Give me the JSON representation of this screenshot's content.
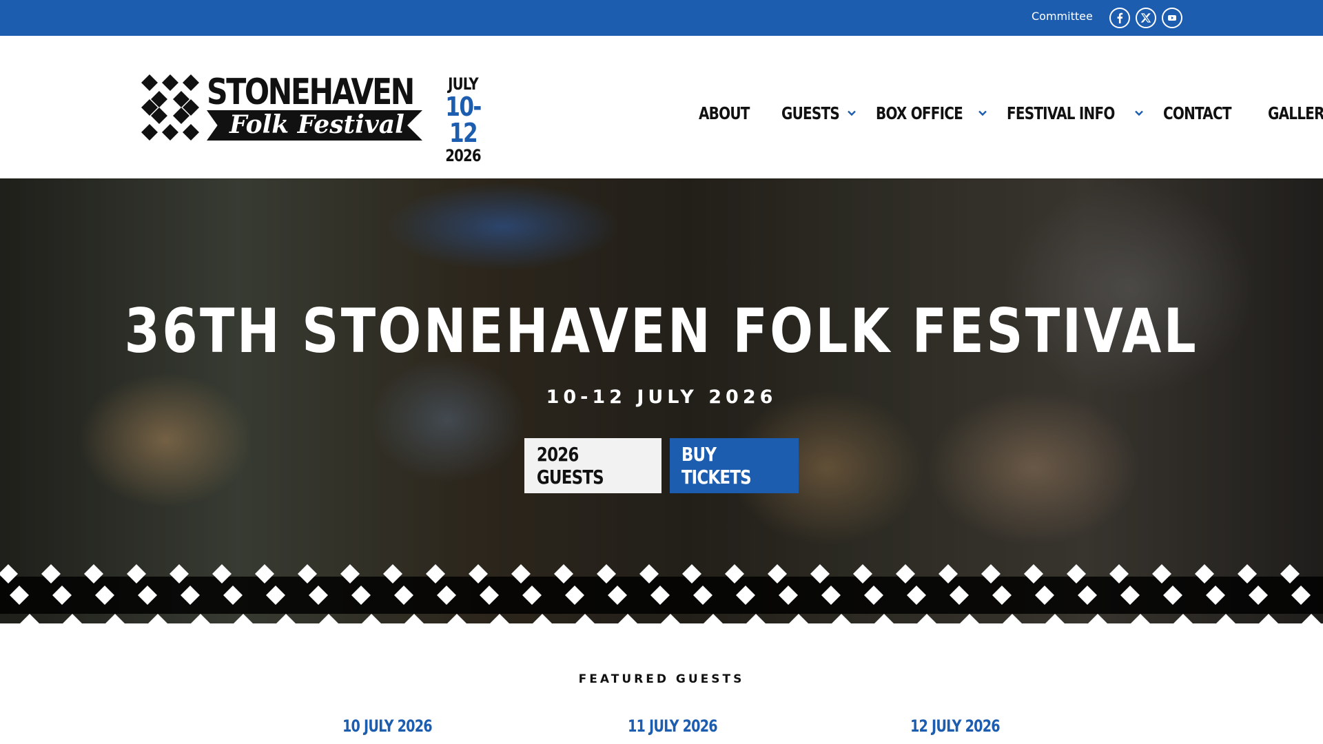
{
  "topbar": {
    "committee_link": "Committee",
    "social": [
      "facebook-icon",
      "x-icon",
      "youtube-icon"
    ],
    "bg_color": "#1d5db0"
  },
  "logo": {
    "word1": "STONEHAVEN",
    "word2": "Folk Festival",
    "month": "JULY",
    "days": "10-12",
    "year": "2026"
  },
  "nav": {
    "items": [
      {
        "label": "ABOUT",
        "has_dropdown": false
      },
      {
        "label": "GUESTS",
        "has_dropdown": true
      },
      {
        "label": "BOX OFFICE",
        "has_dropdown": true
      },
      {
        "label": "FESTIVAL INFO",
        "has_dropdown": true
      },
      {
        "label": "CONTACT",
        "has_dropdown": false
      },
      {
        "label": "GALLERY",
        "has_dropdown": false
      }
    ]
  },
  "hero": {
    "title": "36TH STONEHAVEN FOLK FESTIVAL",
    "subtitle": "10-12 JULY 2026",
    "guests_button": "2026 GUESTS",
    "tickets_button": "BUY TICKETS"
  },
  "featured": {
    "heading": "FEATURED GUESTS",
    "days": [
      "10 JULY 2026",
      "11 JULY 2026",
      "12 JULY 2026"
    ]
  },
  "colors": {
    "accent": "#1d5db0",
    "text": "#111111",
    "button_light": "#f2f2f2"
  }
}
